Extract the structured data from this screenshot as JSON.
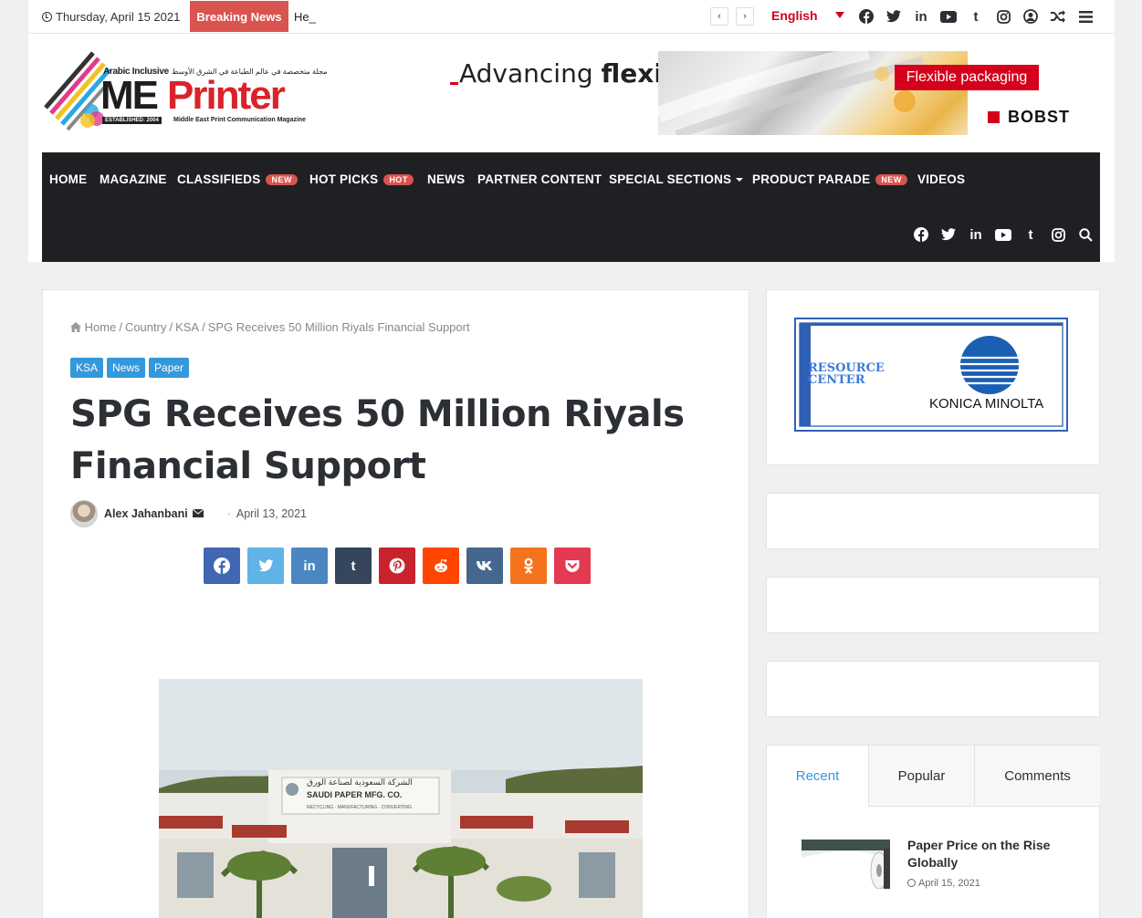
{
  "topbar": {
    "date": "Thursday, April 15 2021",
    "breaking_label": "Breaking News",
    "ticker_text": "He_",
    "prev_label": "‹",
    "next_label": "›",
    "language": "English"
  },
  "header": {
    "logo_arabic_tag": "Arabic Inclusive",
    "logo_arabic_text": "مجلة متخصصة في عالم الطباعة في الشرق الأوسط",
    "logo_me": "ME",
    "logo_printer": "Printer",
    "logo_established": "ESTABLISHED: 2004",
    "logo_subtitle": "Middle East Print Communication Magazine",
    "ad_headline_light": "Advancing",
    "ad_headline_bold": "flexibility",
    "ad_tag": "Flexible packaging",
    "ad_brand": "BOBST"
  },
  "nav": {
    "items": [
      {
        "label": "HOME"
      },
      {
        "label": "MAGAZINE"
      },
      {
        "label": "CLASSIFIEDS",
        "badge": "NEW"
      },
      {
        "label": "HOT PICKS",
        "badge": "HOT"
      },
      {
        "label": "NEWS"
      },
      {
        "label": "PARTNER CONTENT"
      },
      {
        "label": "SPECIAL SECTIONS"
      },
      {
        "label": "PRODUCT PARADE",
        "badge": "NEW"
      },
      {
        "label": "VIDEOS"
      }
    ]
  },
  "article": {
    "breadcrumb": [
      "Home",
      "Country",
      "KSA",
      "SPG Receives 50 Million Riyals Financial Support"
    ],
    "categories": [
      "KSA",
      "News",
      "Paper"
    ],
    "title": "SPG Receives 50 Million Riyals Financial Support",
    "author": "Alex Jahanbani",
    "date": "April 13, 2021",
    "photo_sign_arabic": "الشركة السعودية لصناعة الورق",
    "photo_sign_english": "SAUDI PAPER MFG. CO.",
    "photo_sign_sub": "RECYCLING · MANUFACTURING · CONVERTING"
  },
  "sidebar": {
    "ad_resource_line1": "RESOURCE",
    "ad_resource_line2": "CENTER",
    "ad_brand": "KONICA MINOLTA",
    "tabs": [
      "Recent",
      "Popular",
      "Comments"
    ],
    "recent": {
      "title": "Paper Price on the Rise Globally",
      "date": "April 15, 2021"
    }
  },
  "colors": {
    "accent": "#3498db",
    "breaking": "#d9534f",
    "nav_bg": "#1f2024",
    "language": "#d4001c"
  }
}
